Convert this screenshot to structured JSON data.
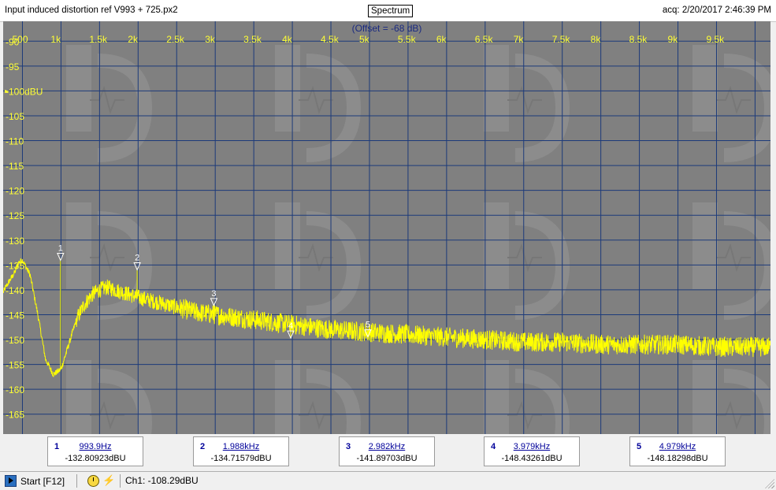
{
  "window": {
    "title": "Input induced distortion ref V993 + 725.px2",
    "mode_button": "Spectrum",
    "acquired": "acq: 2/20/2017 2:46:39 PM"
  },
  "plot": {
    "offset_label": "(Offset = -68 dB)",
    "background_color": "#808080",
    "grid_color": "#1c3a7a",
    "trace_color": "#ffff00",
    "label_color": "#ffff33",
    "x_ticks": [
      "500",
      "1k",
      "1.5k",
      "2k",
      "2.5k",
      "3k",
      "3.5k",
      "4k",
      "4.5k",
      "5k",
      "5.5k",
      "6k",
      "6.5k",
      "7k",
      "7.5k",
      "8k",
      "8.5k",
      "9k",
      "9.5k"
    ],
    "y_ticks": [
      "-90",
      "-95",
      "-100dBU",
      "-105",
      "-110",
      "-115",
      "-120",
      "-125",
      "-130",
      "-135",
      "-140",
      "-145",
      "-150",
      "-155",
      "-160",
      "-165"
    ],
    "x_range_hz": [
      250,
      10200
    ],
    "y_range_dbu": [
      -169,
      -86
    ]
  },
  "chart_data": {
    "type": "line",
    "title": "",
    "xlabel": "",
    "ylabel": "",
    "x_unit": "Hz",
    "y_unit": "dBU",
    "xlim": [
      250,
      10200
    ],
    "ylim": [
      -169,
      -86
    ],
    "grid": true,
    "series": [
      {
        "x": [
          250,
          300,
          400,
          450,
          500,
          600,
          700,
          800,
          900,
          1000,
          1100,
          1200,
          1300,
          1400,
          1500,
          1600,
          1700,
          1800,
          1900,
          2000,
          2250,
          2500,
          2750,
          3000,
          3500,
          4000,
          4500,
          5000,
          5500,
          6000,
          6500,
          7000,
          7500,
          8000,
          8500,
          9000,
          9500,
          10000,
          10200
        ],
        "y": [
          -140.5,
          -139,
          -136.5,
          -134.5,
          -134,
          -137,
          -145,
          -154,
          -157,
          -156,
          -151,
          -146,
          -143,
          -141,
          -140,
          -139.5,
          -140,
          -140.5,
          -141,
          -141.5,
          -142.5,
          -143.5,
          -144.5,
          -145,
          -146,
          -147,
          -148,
          -148.5,
          -149,
          -149.5,
          -150,
          -150.5,
          -150.5,
          -151,
          -151,
          -151,
          -151.5,
          -151.5,
          -151.5
        ]
      }
    ],
    "markers": [
      {
        "id": "1",
        "freq_hz": 993.9,
        "level_dbu": -132.80923
      },
      {
        "id": "2",
        "freq_hz": 1988,
        "level_dbu": -134.71579
      },
      {
        "id": "3",
        "freq_hz": 2982,
        "level_dbu": -141.89703
      },
      {
        "id": "4",
        "freq_hz": 3979,
        "level_dbu": -148.43261
      },
      {
        "id": "5",
        "freq_hz": 4979,
        "level_dbu": -148.18298
      }
    ]
  },
  "readouts": [
    {
      "num": "1",
      "freq": "993.9Hz",
      "value": "-132.80923dBU"
    },
    {
      "num": "2",
      "freq": "1.988kHz",
      "value": "-134.71579dBU"
    },
    {
      "num": "3",
      "freq": "2.982kHz",
      "value": "-141.89703dBU"
    },
    {
      "num": "4",
      "freq": "3.979kHz",
      "value": "-148.43261dBU"
    },
    {
      "num": "5",
      "freq": "4.979kHz",
      "value": "-148.18298dBU"
    }
  ],
  "status": {
    "start_label": "Start [F12]",
    "channel_readout": "Ch1: -108.29dBU",
    "clock_icon": "clock-icon",
    "tool_icon": "lightning-tool-icon"
  }
}
